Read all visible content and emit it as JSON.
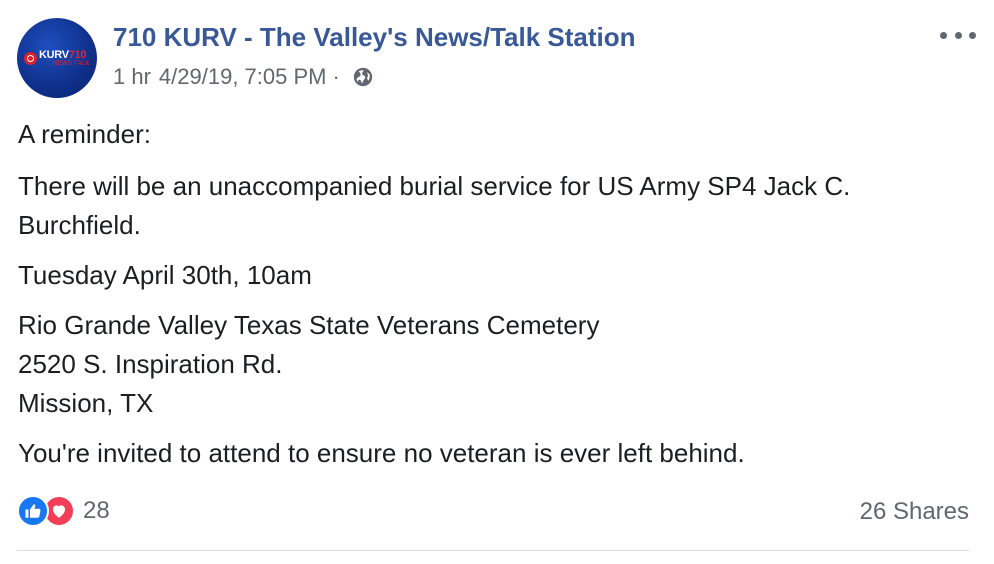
{
  "post": {
    "page_name": "710 KURV - The Valley's News/Talk Station",
    "avatar": {
      "logo_main": "KURV",
      "logo_number": "710",
      "logo_sub": "NEWS TALK"
    },
    "time_relative": "1 hr",
    "timestamp": "4/29/19, 7:05 PM",
    "separator": "·",
    "privacy_icon": "globe-icon",
    "more_icon": "more-options-icon",
    "body": {
      "p1": "A reminder:",
      "p2_line1": "There will be an unaccompanied burial service for US Army SP4 Jack C.",
      "p2_line2": "Burchfield.",
      "p3": "Tuesday April 30th, 10am",
      "p4_line1": "Rio Grande Valley Texas State Veterans Cemetery",
      "p4_line2": "2520 S. Inspiration Rd.",
      "p4_line3": "Mission, TX",
      "p5": "You're invited to attend to ensure no veteran is ever left behind."
    },
    "reactions": {
      "icons": [
        "like-icon",
        "love-icon"
      ],
      "count": "28"
    },
    "shares": "26 Shares"
  },
  "colors": {
    "page_name": "#385898",
    "meta_text": "#616770",
    "body_text": "#1c1e21",
    "like": "#1877f2",
    "love": "#f33e58",
    "divider": "#dadde1"
  }
}
